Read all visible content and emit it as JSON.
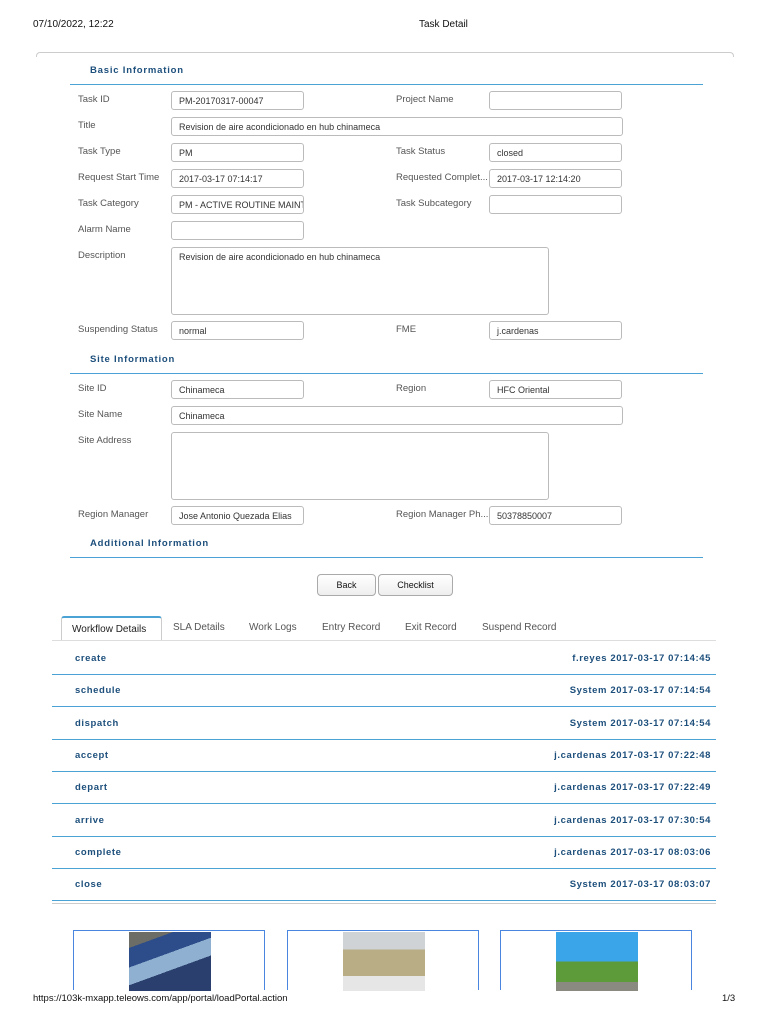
{
  "header": {
    "datetime": "07/10/2022, 12:22",
    "title": "Task Detail"
  },
  "footer": {
    "url": "https://103k-mxapp.teleows.com/app/portal/loadPortal.action",
    "page": "1/3"
  },
  "sections": {
    "basic": "Basic Information",
    "site": "Site Information",
    "additional": "Additional Information"
  },
  "basic": {
    "task_id": {
      "label": "Task ID",
      "value": "PM-20170317-00047"
    },
    "project_name": {
      "label": "Project Name",
      "value": ""
    },
    "title": {
      "label": "Title",
      "value": "Revision de aire acondicionado en hub chinameca"
    },
    "task_type": {
      "label": "Task Type",
      "value": "PM"
    },
    "task_status": {
      "label": "Task Status",
      "value": "closed"
    },
    "request_start": {
      "label": "Request Start Time",
      "value": "2017-03-17 07:14:17"
    },
    "requested_complete": {
      "label": "Requested Complet...",
      "value": "2017-03-17 12:14:20"
    },
    "task_category": {
      "label": "Task Category",
      "value": "PM - ACTIVE ROUTINE MAINT"
    },
    "task_subcategory": {
      "label": "Task Subcategory",
      "value": ""
    },
    "alarm_name": {
      "label": "Alarm Name",
      "value": ""
    },
    "description": {
      "label": "Description",
      "value": "Revision de aire acondicionado en hub chinameca"
    },
    "suspending_status": {
      "label": "Suspending Status",
      "value": "normal"
    },
    "fme": {
      "label": "FME",
      "value": "j.cardenas"
    }
  },
  "site": {
    "site_id": {
      "label": "Site ID",
      "value": "Chinameca"
    },
    "region": {
      "label": "Region",
      "value": "HFC Oriental"
    },
    "site_name": {
      "label": "Site Name",
      "value": "Chinameca"
    },
    "site_address": {
      "label": "Site Address",
      "value": ""
    },
    "region_manager": {
      "label": "Region Manager",
      "value": "Jose Antonio Quezada Elias"
    },
    "region_manager_phone": {
      "label": "Region Manager Ph...",
      "value": "50378850007"
    }
  },
  "buttons": {
    "back": "Back",
    "checklist": "Checklist"
  },
  "tabs": [
    "Workflow Details",
    "SLA Details",
    "Work Logs",
    "Entry Record",
    "Exit Record",
    "Suspend Record"
  ],
  "workflow": [
    {
      "step": "create",
      "info": "f.reyes 2017-03-17 07:14:45"
    },
    {
      "step": "schedule",
      "info": "System 2017-03-17 07:14:54"
    },
    {
      "step": "dispatch",
      "info": "System 2017-03-17 07:14:54"
    },
    {
      "step": "accept",
      "info": "j.cardenas 2017-03-17 07:22:48"
    },
    {
      "step": "depart",
      "info": "j.cardenas 2017-03-17 07:22:49"
    },
    {
      "step": "arrive",
      "info": "j.cardenas 2017-03-17 07:30:54"
    },
    {
      "step": "complete",
      "info": "j.cardenas 2017-03-17 08:03:06"
    },
    {
      "step": "close",
      "info": "System 2017-03-17 08:03:07"
    }
  ]
}
